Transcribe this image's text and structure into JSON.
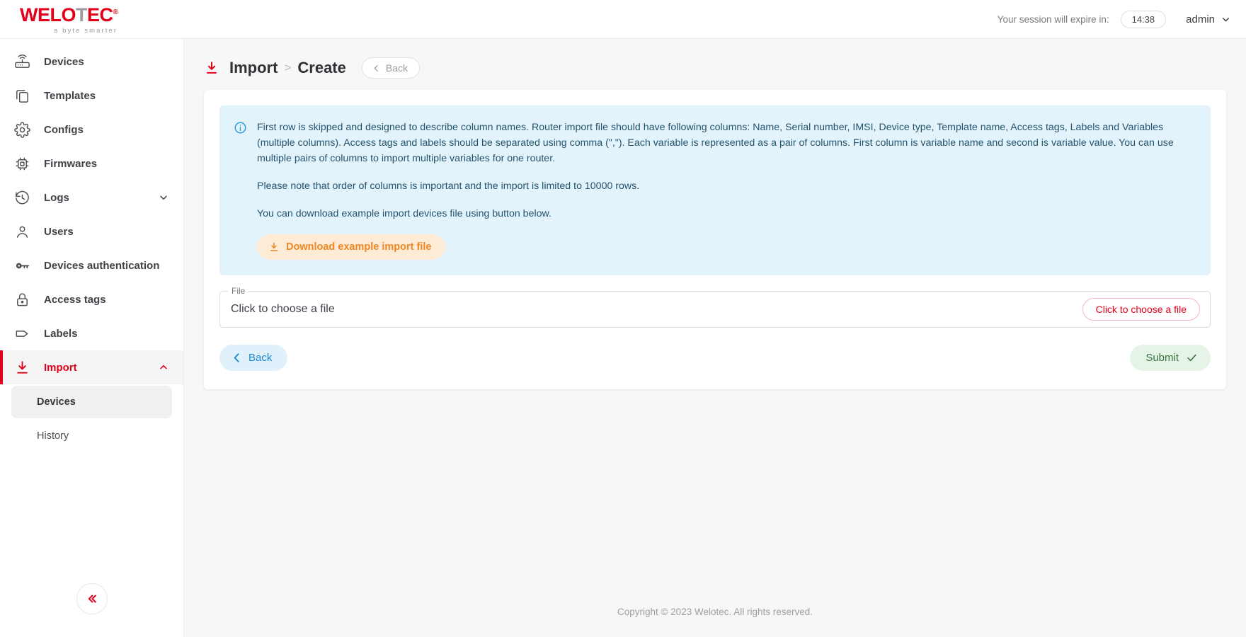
{
  "brand": {
    "logo_main": "WELO",
    "logo_accent": "T",
    "logo_tail": "EC",
    "logo_reg": "®",
    "tagline": "a byte smarter",
    "red": "#e2001a",
    "gray": "#9d9d9d"
  },
  "header": {
    "session_label": "Your session will expire in:",
    "session_timer": "14:38",
    "admin_label": "admin",
    "chevron_icon": "chevron-down-icon"
  },
  "sidebar": {
    "items": [
      {
        "label": "Devices",
        "icon": "router-icon",
        "active": false,
        "expandable": false
      },
      {
        "label": "Templates",
        "icon": "copy-icon",
        "active": false,
        "expandable": false
      },
      {
        "label": "Configs",
        "icon": "gear-icon",
        "active": false,
        "expandable": false
      },
      {
        "label": "Firmwares",
        "icon": "chip-icon",
        "active": false,
        "expandable": false
      },
      {
        "label": "Logs",
        "icon": "history-clock-icon",
        "active": false,
        "expandable": true
      },
      {
        "label": "Users",
        "icon": "user-icon",
        "active": false,
        "expandable": false
      },
      {
        "label": "Devices authentication",
        "icon": "key-icon",
        "active": false,
        "expandable": false
      },
      {
        "label": "Access tags",
        "icon": "lock-icon",
        "active": false,
        "expandable": false
      },
      {
        "label": "Labels",
        "icon": "tag-icon",
        "active": false,
        "expandable": false
      },
      {
        "label": "Import",
        "icon": "download-icon",
        "active": true,
        "expandable": true
      }
    ],
    "sub_items": [
      {
        "label": "Devices",
        "selected": true
      },
      {
        "label": "History",
        "selected": false
      }
    ],
    "collapse_icon": "double-chevron-left-icon"
  },
  "page": {
    "icon": "import-download-icon",
    "breadcrumb_root": "Import",
    "breadcrumb_separator": ">",
    "breadcrumb_current": "Create",
    "back_pill_label": "Back",
    "back_pill_icon": "chevron-left-icon"
  },
  "info": {
    "icon": "info-circle-icon",
    "paragraphs": [
      "First row is skipped and designed to describe column names. Router import file should have following columns: Name, Serial number, IMSI, Device type, Template name, Access tags, Labels and Variables (multiple columns). Access tags and labels should be separated using comma (\",\"). Each variable is represented as a pair of columns. First column is variable name and second is variable value. You can use multiple pairs of columns to import multiple variables for one router.",
      "Please note that order of columns is important and the import is limited to 10000 rows.",
      "You can download example import devices file using button below."
    ],
    "download_button": "Download example import file",
    "download_button_icon": "download-icon"
  },
  "file_field": {
    "legend": "File",
    "value": "Click to choose a file",
    "choose_button": "Click to choose a file"
  },
  "actions": {
    "back_label": "Back",
    "back_icon": "chevron-left-icon",
    "submit_label": "Submit",
    "submit_icon": "check-icon"
  },
  "footer": {
    "copyright": "Copyright © 2023 Welotec. All rights reserved."
  }
}
